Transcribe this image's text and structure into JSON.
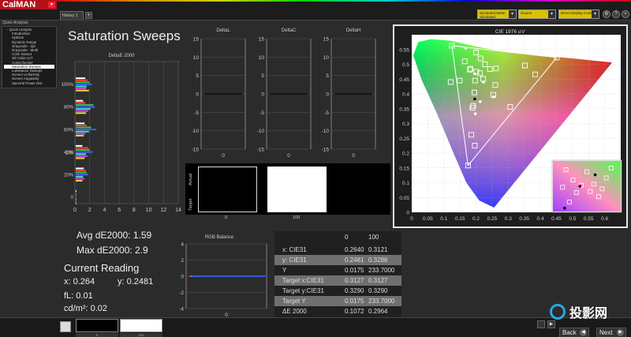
{
  "app": {
    "logo": "CalMAN",
    "tab_label": "History 1",
    "tab_add": "+",
    "dropdowns": [
      {
        "label": "Simulated Meter",
        "sub": "Simulated"
      },
      {
        "label": "Source",
        "sub": ""
      },
      {
        "label": "Direct Display Control",
        "sub": ""
      }
    ]
  },
  "nav": {
    "header": "Quick Analysis",
    "items": [
      {
        "label": "Quick Analysis",
        "top": true,
        "selected": false
      },
      {
        "label": "Introduction",
        "top": false,
        "selected": false
      },
      {
        "label": "Options",
        "top": false,
        "selected": false
      },
      {
        "label": "Dynamic Range",
        "top": false,
        "selected": false
      },
      {
        "label": "Grayscale - 2pt",
        "top": false,
        "selected": false
      },
      {
        "label": "Grayscale - Multi",
        "top": false,
        "selected": false
      },
      {
        "label": "Color Gamut",
        "top": false,
        "selected": false
      },
      {
        "label": "3D Cube LUT",
        "top": false,
        "selected": false
      },
      {
        "label": "ColorChecker",
        "top": false,
        "selected": false
      },
      {
        "label": "Saturation Sweeps",
        "top": false,
        "selected": true
      },
      {
        "label": "Luminance Sweeps",
        "top": false,
        "selected": false
      },
      {
        "label": "Screen Uniformity",
        "top": false,
        "selected": false
      },
      {
        "label": "Screen Angularity",
        "top": false,
        "selected": false
      },
      {
        "label": "Spectral Power Dist",
        "top": false,
        "selected": false
      }
    ]
  },
  "page": {
    "title": "Saturation Sweeps"
  },
  "stats": {
    "avg": "Avg dE2000: 1.59",
    "max": "Max dE2000: 2.9",
    "current_heading": "Current Reading",
    "x": "x: 0.264",
    "y": "y: 0.2481",
    "fl": "fL: 0.01",
    "cd": "cd/m²: 0.02"
  },
  "swatches": {
    "actual_label": "Actual",
    "target_label": "Target",
    "items": [
      {
        "label": "0",
        "color": "#000000"
      },
      {
        "label": "100",
        "color": "#ffffff"
      }
    ]
  },
  "table": {
    "header": [
      "",
      "0",
      "100"
    ],
    "rows": [
      {
        "label": "x: CIE31",
        "v0": "0.2640",
        "v1": "0.3121",
        "hl": false
      },
      {
        "label": "y: CIE31",
        "v0": "0.2481",
        "v1": "0.3286",
        "hl": true
      },
      {
        "label": "Y",
        "v0": "0.0175",
        "v1": "233.7000",
        "hl": false
      },
      {
        "label": "Target x:CIE31",
        "v0": "0.3127",
        "v1": "0.3127",
        "hl": true
      },
      {
        "label": "Target y:CIE31",
        "v0": "0.3290",
        "v1": "0.3290",
        "hl": false
      },
      {
        "label": "Target Y",
        "v0": "0.0175",
        "v1": "233.7000",
        "hl": true
      },
      {
        "label": "ΔE 2000",
        "v0": "0.1072",
        "v1": "0.2964",
        "hl": false
      }
    ]
  },
  "bottom": {
    "swatches": [
      {
        "label": "0",
        "color": "#000000"
      },
      {
        "label": "100",
        "color": "#ffffff"
      }
    ],
    "back_label": "Back",
    "next_label": "Next",
    "watermark_text": "投影网",
    "watermark_sub": "TOUYING.COM"
  },
  "chart_data": [
    {
      "type": "bar",
      "title": "DeltaE 2000",
      "orientation": "horizontal",
      "categories": [
        "0",
        "20%",
        "40%",
        "60%",
        "80%",
        "100%"
      ],
      "series": [
        {
          "color": "#ffffff",
          "values": [
            0.1,
            1.2,
            1.0,
            1.3,
            1.1,
            1.4
          ]
        },
        {
          "color": "#ff4040",
          "values": [
            0.1,
            1.5,
            1.8,
            1.6,
            1.4,
            1.7
          ]
        },
        {
          "color": "#40c040",
          "values": [
            0.1,
            1.6,
            2.0,
            2.2,
            2.5,
            2.0
          ]
        },
        {
          "color": "#4060ff",
          "values": [
            0.1,
            1.8,
            2.4,
            2.9,
            2.7,
            2.3
          ]
        },
        {
          "color": "#40e0e0",
          "values": [
            0.1,
            1.1,
            1.5,
            1.9,
            2.1,
            1.6
          ]
        },
        {
          "color": "#e040e0",
          "values": [
            0.1,
            1.3,
            1.7,
            1.4,
            1.8,
            1.5
          ]
        },
        {
          "color": "#e0e040",
          "values": [
            0.1,
            1.0,
            1.3,
            1.2,
            1.5,
            1.9
          ]
        }
      ],
      "xlim": [
        0,
        14
      ],
      "xticks": [
        0,
        2,
        4,
        6,
        8,
        10,
        12,
        14
      ],
      "yticks": [
        "0",
        "20%",
        "40%",
        "60%",
        "80%",
        "100%"
      ],
      "ytick_extra": [
        "100"
      ]
    },
    {
      "type": "bar",
      "title": "DeltaL",
      "categories": [
        "0"
      ],
      "values": [
        0
      ],
      "ylim": [
        -15,
        15
      ],
      "yticks": [
        15,
        10,
        5,
        0,
        -5,
        -10,
        -15
      ],
      "xticks": [
        "0"
      ]
    },
    {
      "type": "bar",
      "title": "DeltaC",
      "categories": [
        "0"
      ],
      "values": [
        0
      ],
      "ylim": [
        -15,
        15
      ],
      "yticks": [
        15,
        10,
        5,
        0,
        -5,
        -10,
        -15
      ],
      "xticks": [
        "0"
      ]
    },
    {
      "type": "bar",
      "title": "DeltaH",
      "categories": [
        "0"
      ],
      "values": [
        0
      ],
      "ylim": [
        -15,
        15
      ],
      "yticks": [
        15,
        10,
        5,
        0,
        -5,
        -10,
        -15
      ],
      "xticks": [
        "0"
      ]
    },
    {
      "type": "bar",
      "title": "RGB Balance",
      "categories": [
        "0"
      ],
      "series": [
        {
          "color": "#ff3030",
          "values": [
            0
          ]
        },
        {
          "color": "#30c030",
          "values": [
            0
          ]
        },
        {
          "color": "#3050ff",
          "values": [
            0
          ]
        }
      ],
      "ylim": [
        -4,
        4
      ],
      "yticks": [
        4,
        2,
        0,
        -2,
        -4
      ],
      "xticks": [
        "0"
      ]
    },
    {
      "type": "scatter",
      "title": "CIE 1976 u'v'",
      "xlim": [
        0,
        0.65
      ],
      "ylim": [
        0,
        0.6
      ],
      "xticks": [
        "0",
        "0.05",
        "0.1",
        "0.15",
        "0.2",
        "0.25",
        "0.3",
        "0.35",
        "0.4",
        "0.45",
        "0.5",
        "0.55",
        "0.6"
      ],
      "yticks": [
        "0",
        "0.05",
        "0.1",
        "0.15",
        "0.2",
        "0.25",
        "0.3",
        "0.35",
        "0.4",
        "0.45",
        "0.5",
        "0.55"
      ],
      "targets": [
        {
          "u": 0.451,
          "v": 0.523
        },
        {
          "u": 0.125,
          "v": 0.563
        },
        {
          "u": 0.175,
          "v": 0.158
        },
        {
          "u": 0.384,
          "v": 0.466
        },
        {
          "u": 0.149,
          "v": 0.445
        },
        {
          "u": 0.306,
          "v": 0.356
        },
        {
          "u": 0.352,
          "v": 0.496
        },
        {
          "u": 0.165,
          "v": 0.51
        },
        {
          "u": 0.185,
          "v": 0.262
        },
        {
          "u": 0.254,
          "v": 0.397
        },
        {
          "u": 0.189,
          "v": 0.353
        },
        {
          "u": 0.222,
          "v": 0.451
        },
        {
          "u": 0.262,
          "v": 0.486
        },
        {
          "u": 0.183,
          "v": 0.485
        },
        {
          "u": 0.195,
          "v": 0.405
        },
        {
          "u": 0.121,
          "v": 0.44
        },
        {
          "u": 0.181,
          "v": 0.482
        },
        {
          "u": 0.201,
          "v": 0.475
        },
        {
          "u": 0.212,
          "v": 0.47
        },
        {
          "u": 0.2,
          "v": 0.54
        },
        {
          "u": 0.214,
          "v": 0.52
        },
        {
          "u": 0.228,
          "v": 0.5
        },
        {
          "u": 0.243,
          "v": 0.484
        },
        {
          "u": 0.26,
          "v": 0.43
        },
        {
          "u": 0.197,
          "v": 0.445
        },
        {
          "u": 0.191,
          "v": 0.36
        },
        {
          "u": 0.196,
          "v": 0.225
        }
      ],
      "measured": [
        {
          "u": 0.168,
          "v": 0.555,
          "color": "#ffffff"
        },
        {
          "u": 0.196,
          "v": 0.468,
          "color": "#ffffff"
        },
        {
          "u": 0.223,
          "v": 0.44,
          "color": "#ffffff"
        },
        {
          "u": 0.196,
          "v": 0.383,
          "color": "#000000"
        },
        {
          "u": 0.213,
          "v": 0.374,
          "color": "#ffffff"
        },
        {
          "u": 0.255,
          "v": 0.39,
          "color": "#ffffff"
        },
        {
          "u": 0.198,
          "v": 0.333,
          "color": "#ffffff"
        }
      ]
    }
  ]
}
